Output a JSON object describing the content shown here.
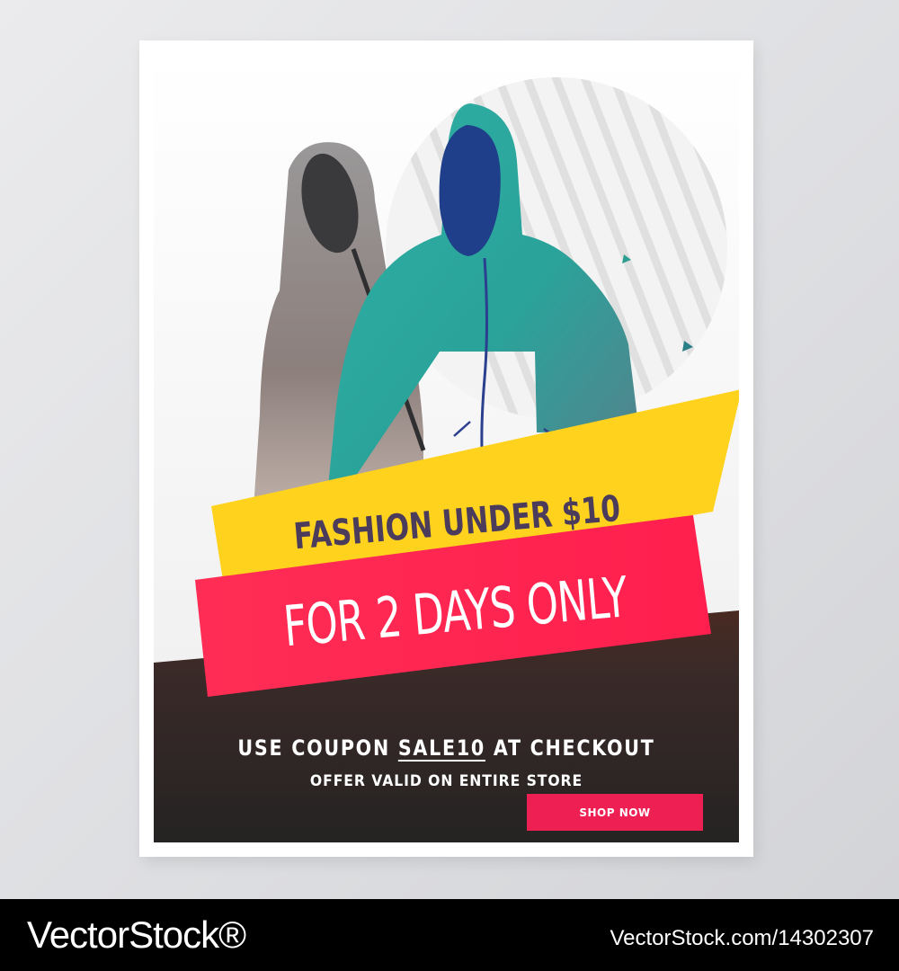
{
  "flyer": {
    "headline_line1": "Fashion under $10",
    "headline_line2": "For 2 days only",
    "coupon_prefix": "Use coupon ",
    "coupon_code": "SALE10",
    "coupon_suffix": " at checkout",
    "offer_note": "Offer valid on entire store",
    "shop_button_label": "Shop now"
  },
  "watermark": {
    "brand": "VectorStock®",
    "image_id": "VectorStock.com/14302307"
  },
  "icons": [
    "hoodie-icon",
    "hoodie-icon",
    "striped-circle",
    "triangle-confetti"
  ],
  "colors": {
    "yellow_banner": "#ffd21e",
    "red_banner": "#ff2d55",
    "teal_hoodie": "#25a9a0",
    "grey_hoodie": "#8c8a8c",
    "dark_panel": "#2d2a2a",
    "button": "#ee1f53"
  }
}
